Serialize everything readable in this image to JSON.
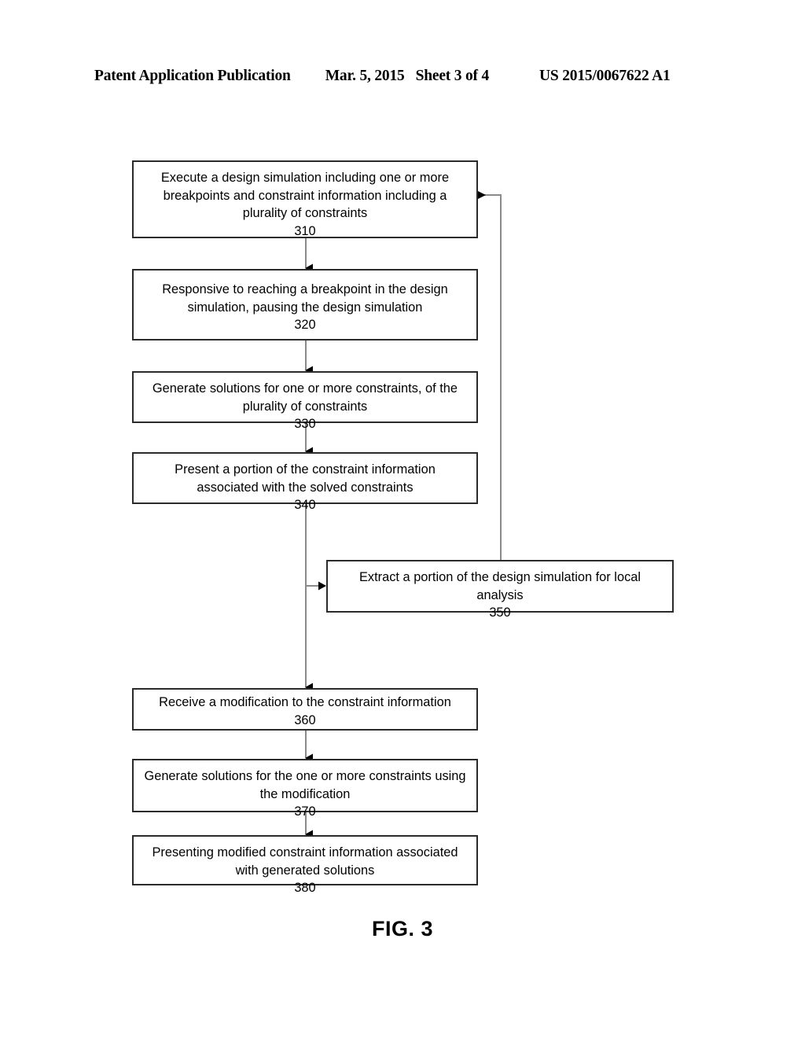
{
  "header": {
    "publication": "Patent Application Publication",
    "date": "Mar. 5, 2015",
    "sheet": "Sheet 3 of 4",
    "patent_number": "US 2015/0067622 A1"
  },
  "figure": {
    "caption": "FIG. 3"
  },
  "flow": {
    "boxes": [
      {
        "id": "310",
        "text": "Execute a design simulation including one or more breakpoints and constraint information including a plurality of constraints",
        "ref": "310"
      },
      {
        "id": "320",
        "text": "Responsive to reaching a breakpoint in the design simulation, pausing the design simulation",
        "ref": "320"
      },
      {
        "id": "330",
        "text": "Generate solutions for one or more constraints, of the plurality of constraints",
        "ref": "330"
      },
      {
        "id": "340",
        "text": "Present a portion of the constraint information associated with the solved constraints",
        "ref": "340"
      },
      {
        "id": "350",
        "text": "Extract a portion of the design simulation for local analysis",
        "ref": "350"
      },
      {
        "id": "360",
        "text": "Receive a modification to the constraint information",
        "ref": "360"
      },
      {
        "id": "370",
        "text": "Generate solutions for the one or more constraints using the modification",
        "ref": "370"
      },
      {
        "id": "380",
        "text": "Presenting modified constraint information associated with generated solutions",
        "ref": "380"
      }
    ],
    "connectors": [
      {
        "from": "310",
        "to": "320",
        "kind": "down-arrow"
      },
      {
        "from": "320",
        "to": "330",
        "kind": "down-arrow"
      },
      {
        "from": "330",
        "to": "340",
        "kind": "down-arrow"
      },
      {
        "from": "340",
        "to": "350",
        "kind": "branch-right-arrow"
      },
      {
        "from": "340",
        "to": "360",
        "kind": "down-arrow"
      },
      {
        "from": "360",
        "to": "370",
        "kind": "down-arrow"
      },
      {
        "from": "370",
        "to": "380",
        "kind": "down-arrow"
      },
      {
        "from": "350",
        "to": "310",
        "kind": "feedback-up-left-arrow"
      }
    ]
  },
  "style": {
    "box_border_color": "#2b2b2b",
    "connector_color": "#8a8a8a",
    "arrowhead_color": "#000000",
    "text_color": "#000000",
    "background_color": "#ffffff"
  }
}
